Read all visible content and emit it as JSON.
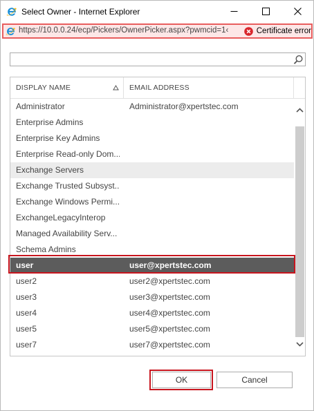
{
  "window": {
    "title": "Select Owner - Internet Explorer",
    "icon": "ie-logo-icon",
    "controls": {
      "minimize": "minimize-icon",
      "maximize": "maximize-icon",
      "close": "close-icon"
    }
  },
  "address_bar": {
    "url": "https://10.0.0.24/ecp/Pickers/OwnerPicker.aspx?pwmcid=1‹",
    "certificate_label": "Certificate error",
    "colors": {
      "background": "#fde7e7",
      "border": "#e85d5d",
      "error_icon": "#d9262c"
    }
  },
  "search": {
    "value": "",
    "placeholder": "",
    "icon": "search-icon"
  },
  "list": {
    "columns": [
      {
        "label": "DISPLAY NAME",
        "sort": "ascending"
      },
      {
        "label": "EMAIL ADDRESS"
      }
    ],
    "rows": [
      {
        "name": "Administrator",
        "email": "Administrator@xpertstec.com"
      },
      {
        "name": "Enterprise Admins",
        "email": ""
      },
      {
        "name": "Enterprise Key Admins",
        "email": ""
      },
      {
        "name": "Enterprise Read-only Dom...",
        "email": ""
      },
      {
        "name": "Exchange Servers",
        "email": "",
        "state": "hover"
      },
      {
        "name": "Exchange Trusted Subsyst...",
        "email": ""
      },
      {
        "name": "Exchange Windows Permi...",
        "email": ""
      },
      {
        "name": "ExchangeLegacyInterop",
        "email": ""
      },
      {
        "name": "Managed Availability Serv...",
        "email": ""
      },
      {
        "name": "Schema Admins",
        "email": ""
      },
      {
        "name": "user",
        "email": "user@xpertstec.com",
        "state": "selected"
      },
      {
        "name": "user2",
        "email": "user2@xpertstec.com"
      },
      {
        "name": "user3",
        "email": "user3@xpertstec.com"
      },
      {
        "name": "user4",
        "email": "user4@xpertstec.com"
      },
      {
        "name": "user5",
        "email": "user5@xpertstec.com"
      },
      {
        "name": "user7",
        "email": "user7@xpertstec.com"
      }
    ],
    "colors": {
      "selected_row": "#5c5c5c",
      "hover_row": "#ececec",
      "highlight_outline": "#c8151e"
    }
  },
  "buttons": {
    "ok_label": "OK",
    "cancel_label": "Cancel"
  }
}
